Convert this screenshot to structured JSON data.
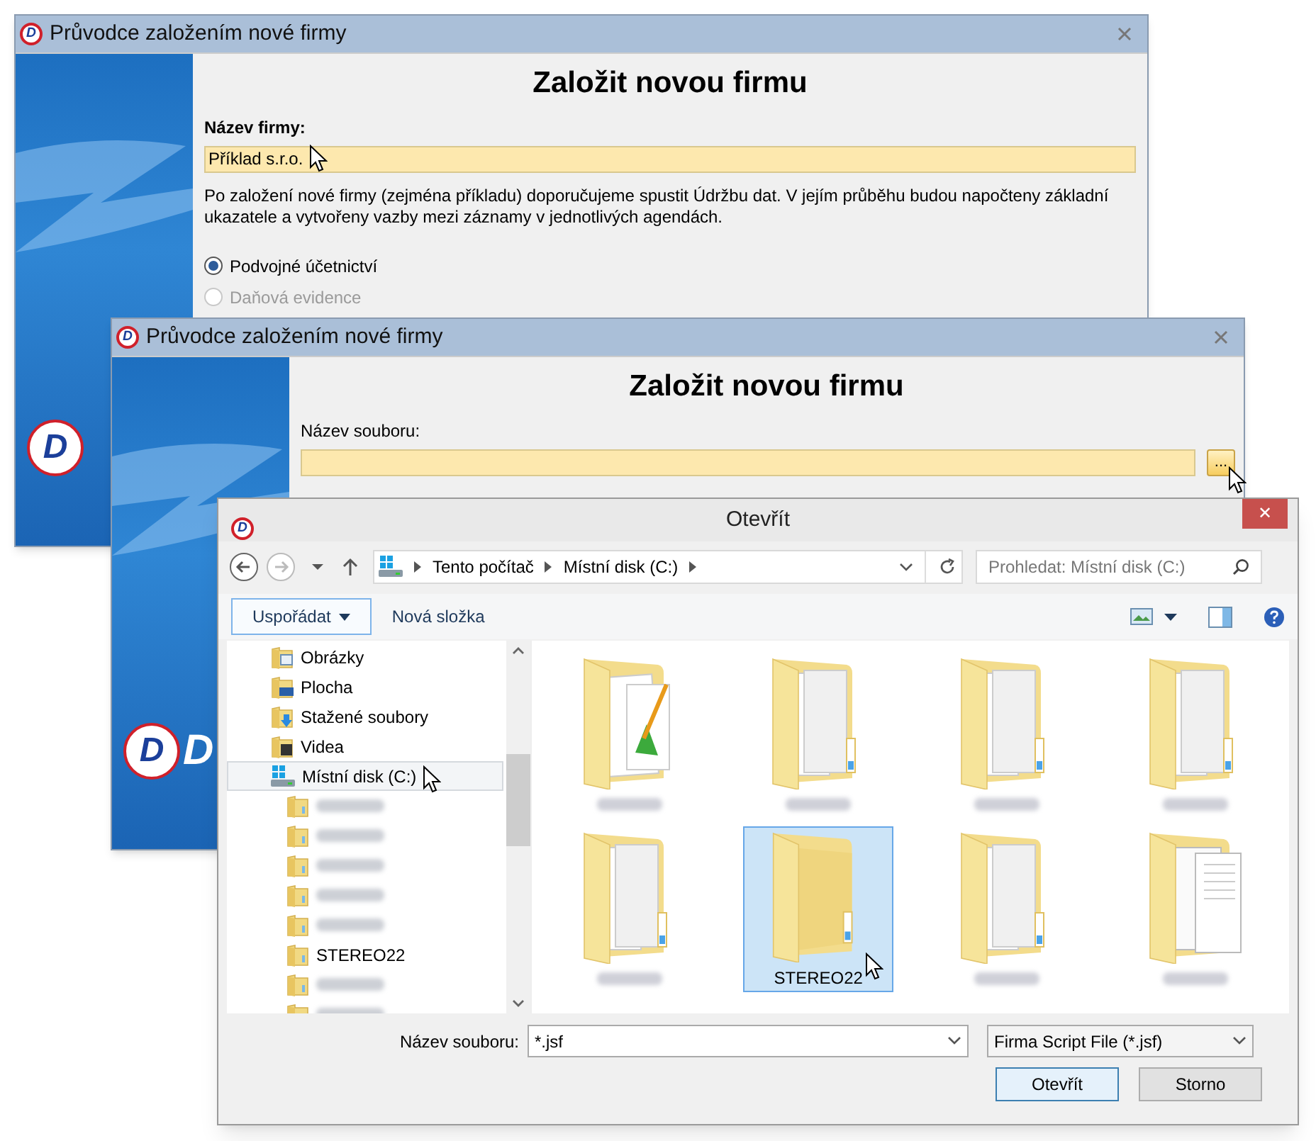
{
  "windows": [
    {
      "title": "Průvodce založením nové firmy",
      "icon_letter": "D",
      "logo_mark": "D",
      "heading": "Založit novou firmu",
      "field_label": "Název firmy:",
      "label_bold": true,
      "field_value": "Příklad s.r.o.",
      "info": "Po založení nové firmy (zejména příkladu) doporučujeme spustit Údržbu dat. V jejím průběhu budou napočteny základní ukazatele a vytvořeny vazby mezi záznamy v jednotlivých agendách.",
      "radios": [
        {
          "label": "Podvojné účetnictví",
          "selected": true,
          "disabled": false
        },
        {
          "label": "Daňová evidence",
          "selected": false,
          "disabled": true
        }
      ]
    },
    {
      "title": "Průvodce založením nové firmy",
      "icon_letter": "D",
      "logo_mark": "D",
      "logo_text": "D",
      "heading": "Založit novou firmu",
      "field_label": "Název souboru:",
      "label_bold": false,
      "browse": "..."
    }
  ],
  "dialog": {
    "title": "Otevřít",
    "icon_letter": "D",
    "close": "✕",
    "breadcrumb": [
      "Tento počítač",
      "Místní disk (C:)"
    ],
    "search": {
      "placeholder": "Prohledat: Místní disk (C:)"
    },
    "organize": "Uspořádat",
    "new_folder": "Nová složka",
    "nav": [
      {
        "kind": "pictures",
        "label": "Obrázky",
        "selected": false
      },
      {
        "kind": "desktop",
        "label": "Plocha",
        "selected": false
      },
      {
        "kind": "downloads",
        "label": "Stažené soubory",
        "selected": false
      },
      {
        "kind": "videos",
        "label": "Videa",
        "selected": false
      },
      {
        "kind": "drive",
        "label": "Místní disk (C:)",
        "selected": true,
        "children": [
          {
            "kind": "blurred",
            "selected": false
          },
          {
            "kind": "blurred",
            "selected": false
          },
          {
            "kind": "blurred",
            "selected": false
          },
          {
            "kind": "blurred",
            "selected": false
          },
          {
            "kind": "blurred",
            "selected": false
          },
          {
            "kind": "folder",
            "label": "STEREO22",
            "selected": false
          },
          {
            "kind": "blurred",
            "selected": false
          },
          {
            "kind": "blurred",
            "selected": false
          }
        ]
      }
    ],
    "items": [
      {
        "kind": "pictures",
        "selected": false
      },
      {
        "kind": "documents",
        "selected": false
      },
      {
        "kind": "documents",
        "selected": false
      },
      {
        "kind": "documents",
        "selected": false
      },
      {
        "kind": "documents",
        "selected": false
      },
      {
        "kind": "empty",
        "label": "STEREO22",
        "selected": true
      },
      {
        "kind": "documents",
        "selected": false
      },
      {
        "kind": "files",
        "selected": false
      }
    ],
    "filename_label": "Název souboru:",
    "filename_value": "*.jsf",
    "filter": "Firma Script File (*.jsf)",
    "buttons": [
      {
        "label": "Otevřít",
        "default": true
      },
      {
        "label": "Storno",
        "default": false
      }
    ]
  }
}
